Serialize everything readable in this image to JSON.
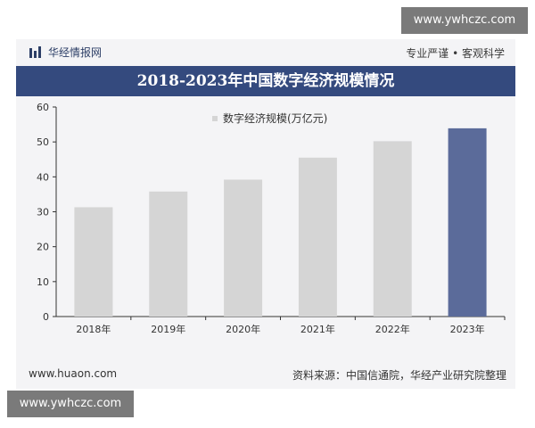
{
  "watermark": {
    "top": "www.ywhczc.com",
    "bottom": "www.ywhczc.com"
  },
  "header": {
    "brand": "华经情报网",
    "slogan": "专业严谨 • 客观科学",
    "title": "2018-2023年中国数字经济规模情况"
  },
  "footer": {
    "site": "www.huaon.com",
    "source": "资料来源：中国信通院，华经产业研究院整理"
  },
  "colors": {
    "title_band": "#344a7e",
    "bar": "#d5d5d5",
    "highlight_bar": "#5b6b9a"
  },
  "chart_data": {
    "type": "bar",
    "title": "2018-2023年中国数字经济规模情况",
    "categories": [
      "2018年",
      "2019年",
      "2020年",
      "2021年",
      "2022年",
      "2023年"
    ],
    "series": [
      {
        "name": "数字经济规模(万亿元)",
        "values": [
          31.3,
          35.8,
          39.2,
          45.5,
          50.2,
          53.9
        ]
      }
    ],
    "ylim": [
      0,
      60
    ],
    "yticks": [
      0,
      10,
      20,
      30,
      40,
      50,
      60
    ],
    "xlabel": "",
    "ylabel": "",
    "highlight_category": "2023年",
    "legend_position": "top"
  }
}
